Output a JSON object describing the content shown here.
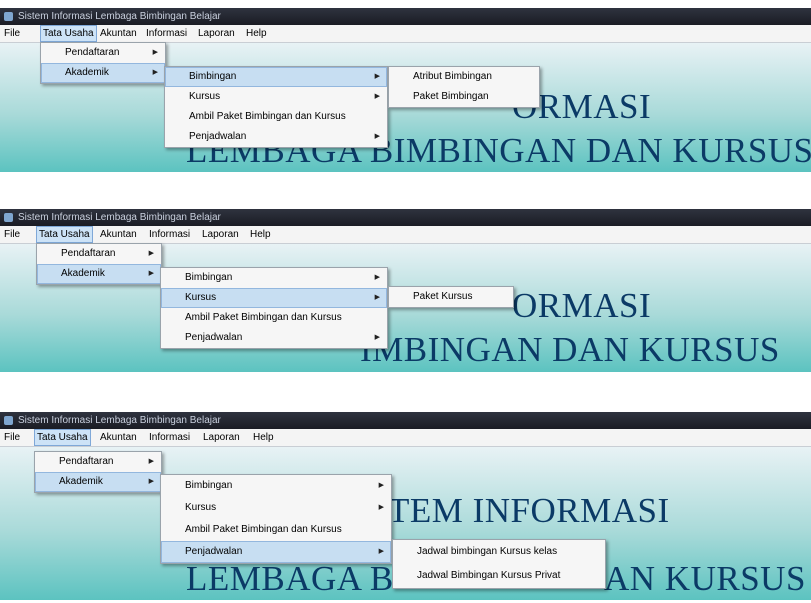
{
  "window_title": "Sistem Informasi Lembaga Bimbingan Belajar",
  "menubar": [
    "File",
    "Tata Usaha",
    "Akuntan",
    "Informasi",
    "Laporan",
    "Help"
  ],
  "tata_usaha_menu": [
    "Pendaftaran",
    "Akademik"
  ],
  "akademik_menu": [
    "Bimbingan",
    "Kursus",
    "Ambil Paket Bimbingan dan Kursus",
    "Penjadwalan"
  ],
  "bimbingan_menu": [
    "Atribut Bimbingan",
    "Paket Bimbingan"
  ],
  "kursus_menu": [
    "Paket Kursus"
  ],
  "penjadwalan_menu": [
    "Jadwal bimbingan  Kursus kelas",
    "Jadwal Bimbingan  Kursus Privat"
  ],
  "banner": {
    "line1_p1": "ORMASI",
    "line2_p1": "LEMBAGA BIMBINGAN DAN KURSUS",
    "line2_p2": "IMBINGAN DAN KURSUS",
    "line1_p3": "TEM INFORMASI",
    "line2_p3": "LEMBAGA B",
    "line2_p3b": "AN KURSUS"
  },
  "colors": {
    "banner_text": "#0b3a66",
    "menu_highlight": "#cde3f7",
    "background_gradient_end": "#5cc3c0"
  }
}
